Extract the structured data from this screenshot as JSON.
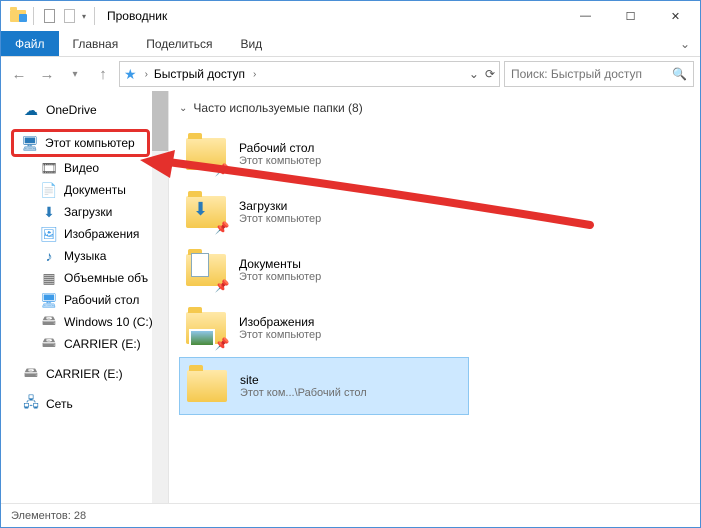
{
  "title": "Проводник",
  "ribbon": {
    "file": "Файл",
    "home": "Главная",
    "share": "Поделиться",
    "view": "Вид"
  },
  "address": {
    "text": "Быстрый доступ"
  },
  "search": {
    "placeholder": "Поиск: Быстрый доступ"
  },
  "sidebar": {
    "onedrive": "OneDrive",
    "thispc": "Этот компьютер",
    "video": "Видео",
    "documents": "Документы",
    "downloads": "Загрузки",
    "pictures": "Изображения",
    "music": "Музыка",
    "volumes": "Объемные объ",
    "desktop": "Рабочий стол",
    "cdrive": "Windows 10 (C:)",
    "edrive": "CARRIER (E:)",
    "edrive2": "CARRIER (E:)",
    "network": "Сеть"
  },
  "group": {
    "title": "Часто используемые папки (8)"
  },
  "items": [
    {
      "name": "Рабочий стол",
      "sub": "Этот компьютер",
      "icon": "desktop"
    },
    {
      "name": "Загрузки",
      "sub": "Этот компьютер",
      "icon": "downloads"
    },
    {
      "name": "Документы",
      "sub": "Этот компьютер",
      "icon": "documents"
    },
    {
      "name": "Изображения",
      "sub": "Этот компьютер",
      "icon": "pictures"
    },
    {
      "name": "site",
      "sub": "Этот ком...\\Рабочий стол",
      "icon": "folder",
      "selected": true
    }
  ],
  "status": {
    "label": "Элементов:",
    "count": "28"
  }
}
